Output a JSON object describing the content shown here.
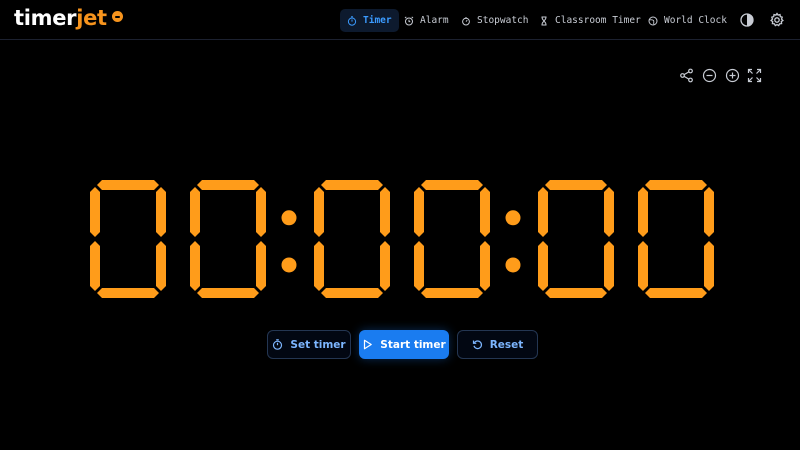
{
  "brand": {
    "name_part1": "timer",
    "name_part2": "jet",
    "accent_color": "#f7941d"
  },
  "nav": [
    {
      "label": "Timer",
      "icon": "stopwatch-icon",
      "active": true
    },
    {
      "label": "Alarm",
      "icon": "alarm-clock-icon",
      "active": false
    },
    {
      "label": "Stopwatch",
      "icon": "stopwatch-icon",
      "active": false
    },
    {
      "label": "Classroom Timer",
      "icon": "hourglass-icon",
      "active": false
    },
    {
      "label": "World Clock",
      "icon": "globe-icon",
      "active": false
    }
  ],
  "header_icons": [
    "theme-toggle-icon",
    "settings-gear-icon"
  ],
  "toolbar": [
    "share-icon",
    "zoom-out-icon",
    "zoom-in-icon",
    "fullscreen-icon"
  ],
  "timer": {
    "display": "00:00:00",
    "digit_color": "#ff9c1a"
  },
  "buttons": {
    "set_timer": "Set timer",
    "start_timer": "Start timer",
    "reset": "Reset"
  },
  "colors": {
    "background": "#000000",
    "primary": "#1a7cf0",
    "active_nav": "#3b9bff"
  }
}
